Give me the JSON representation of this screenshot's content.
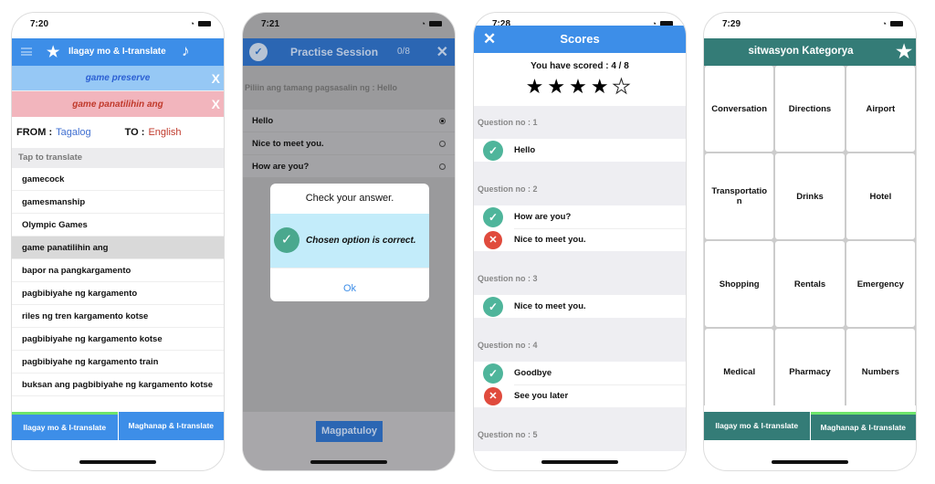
{
  "screens": [
    {
      "status_time": "7:20",
      "nav": {
        "title": "Ilagay mo & I-translate"
      },
      "translation_bar": {
        "text": "game preserve",
        "close": "X"
      },
      "source_bar": {
        "text": "game panatilihin ang",
        "close": "X"
      },
      "from_label": "FROM :",
      "from_lang": "Tagalog",
      "to_label": "TO :",
      "to_lang": "English",
      "list_header": "Tap to translate",
      "words": [
        "gamecock",
        "gamesmanship",
        "Olympic Games",
        "game panatilihin ang",
        "bapor na pangkargamento",
        "pagbibiyahe ng kargamento",
        "riles ng tren kargamento kotse",
        "pagbibiyahe ng kargamento kotse",
        "pagbibiyahe ng kargamento train",
        "buksan ang pagbibiyahe ng kargamento kotse"
      ],
      "selected_index": 3,
      "tabs": [
        "Ilagay mo & I-translate",
        "Maghanap & I-translate"
      ],
      "active_tab": 0
    },
    {
      "status_time": "7:21",
      "nav": {
        "title": "Practise Session",
        "progress": "0/8",
        "close": "✕"
      },
      "question": "Piliin ang tamang pagsasalin ng : Hello",
      "options": [
        "Hello",
        "Nice to meet you.",
        "How are you?"
      ],
      "selected_option": 0,
      "dialog": {
        "title": "Check your answer.",
        "message": "Chosen option is correct.",
        "ok": "Ok"
      },
      "continue": "Magpatuloy"
    },
    {
      "status_time": "7:28",
      "nav": {
        "title": "Scores",
        "close": "✕"
      },
      "score_text": "You have scored : 4 / 8",
      "rating": {
        "filled": 4,
        "total": 5
      },
      "questions": [
        {
          "label": "Question no : 1",
          "answers": [
            {
              "text": "Hello",
              "correct": true
            }
          ]
        },
        {
          "label": "Question no : 2",
          "answers": [
            {
              "text": "How are you?",
              "correct": true
            },
            {
              "text": "Nice to meet you.",
              "correct": false
            }
          ]
        },
        {
          "label": "Question no : 3",
          "answers": [
            {
              "text": "Nice to meet you.",
              "correct": true
            }
          ]
        },
        {
          "label": "Question no : 4",
          "answers": [
            {
              "text": "Goodbye",
              "correct": true
            },
            {
              "text": "See you later",
              "correct": false
            }
          ]
        },
        {
          "label": "Question no : 5",
          "answers": []
        }
      ]
    },
    {
      "status_time": "7:29",
      "nav": {
        "title": "sitwasyon Kategorya"
      },
      "categories": [
        "Conversation",
        "Directions",
        "Airport",
        "Transportatio n",
        "Drinks",
        "Hotel",
        "Shopping",
        "Rentals",
        "Emergency",
        "Medical",
        "Pharmacy",
        "Numbers"
      ],
      "tabs": [
        "Ilagay mo & I-translate",
        "Maghanap & I-translate"
      ],
      "active_tab": 1
    }
  ],
  "colors": {
    "blue": "#3d8ee8",
    "teal": "#347c77",
    "correct": "#4fb59b",
    "wrong": "#e04b3d",
    "active_tab": "#6ee46b"
  }
}
